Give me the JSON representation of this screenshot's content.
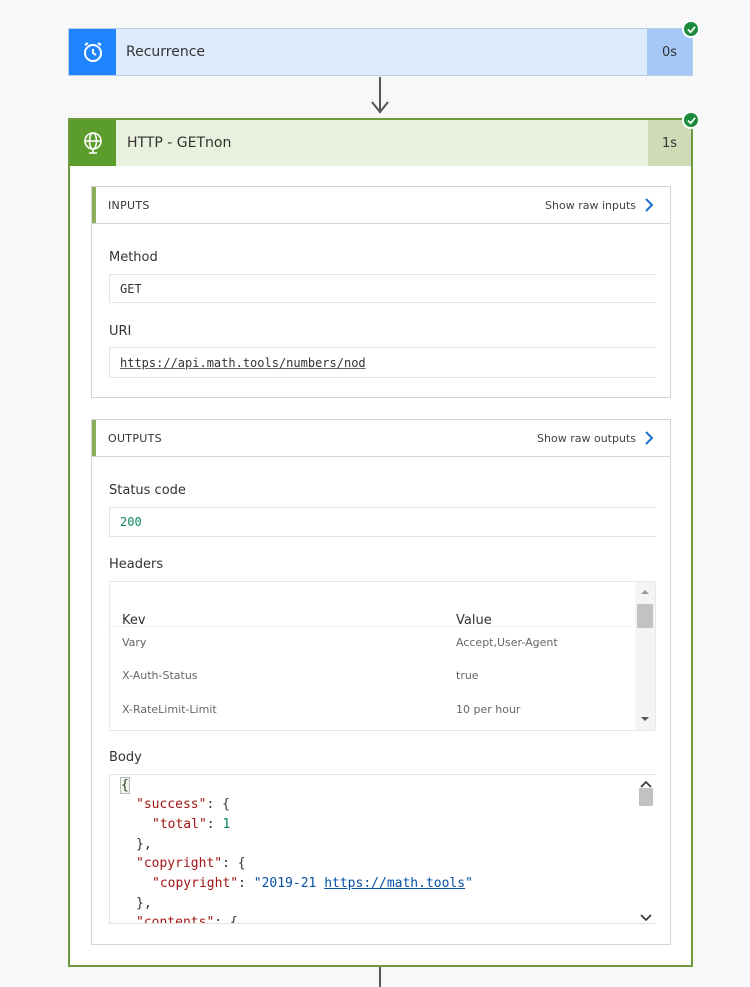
{
  "recurrence": {
    "title": "Recurrence",
    "duration": "0s",
    "icon": "alarm-clock-icon",
    "status": "succeeded"
  },
  "http": {
    "title": "HTTP - GETnon",
    "duration": "1s",
    "icon": "globe-icon",
    "status": "succeeded",
    "inputs": {
      "label": "INPUTS",
      "raw_link": "Show raw inputs",
      "method_label": "Method",
      "method_value": "GET",
      "uri_label": "URI",
      "uri_value": "https://api.math.tools/numbers/nod"
    },
    "outputs": {
      "label": "OUTPUTS",
      "raw_link": "Show raw outputs",
      "status_label": "Status code",
      "status_value": "200",
      "headers_label": "Headers",
      "headers_columns": [
        "Kev",
        "Value"
      ],
      "headers_rows": [
        {
          "key": "Vary",
          "value": "Accept,User-Agent"
        },
        {
          "key": "X-Auth-Status",
          "value": "true"
        },
        {
          "key": "X-RateLimit-Limit",
          "value": "10 per hour"
        }
      ],
      "body_label": "Body",
      "body": {
        "open_brace": "{",
        "k_success": "\"success\"",
        "k_total": "\"total\"",
        "v_total": "1",
        "k_copyright": "\"copyright\"",
        "k_copyright_inner": "\"copyright\"",
        "v_copyright_text": "\"2019-21 ",
        "v_copyright_url": "https://math.tools",
        "v_copyright_end": "\"",
        "k_contents": "\"contents\""
      }
    }
  },
  "colors": {
    "success_green": "#1c8a3c",
    "recurrence_blue": "#1f85ff",
    "http_green": "#5c9c2c"
  }
}
